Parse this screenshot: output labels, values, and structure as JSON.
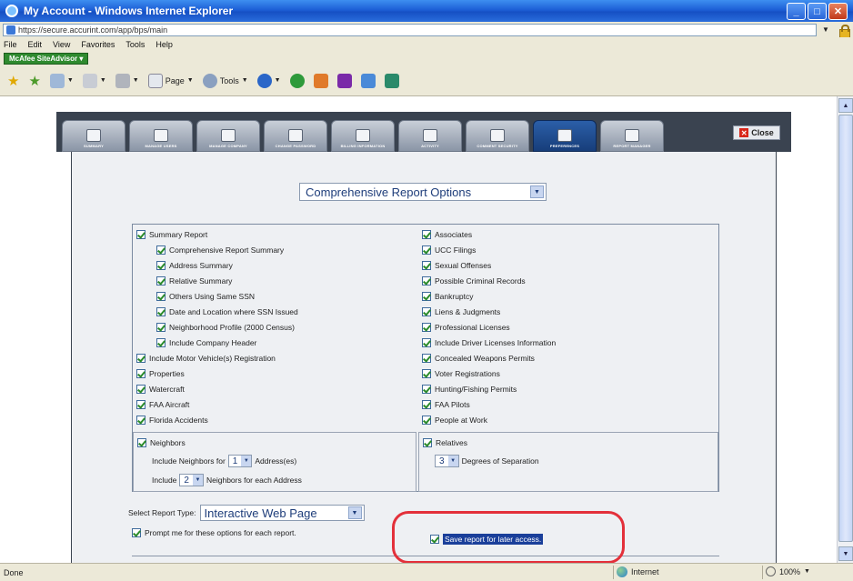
{
  "window": {
    "title": "My Account - Windows Internet Explorer"
  },
  "address": {
    "url": "https://secure.accurint.com/app/bps/main"
  },
  "menu": [
    "File",
    "Edit",
    "View",
    "Favorites",
    "Tools",
    "Help"
  ],
  "mcafee": {
    "label": "McAfee SiteAdvisor ▾"
  },
  "toolbar": {
    "page_label": "Page",
    "tools_label": "Tools"
  },
  "tabs": [
    {
      "label": "Summary"
    },
    {
      "label": "Manage Users"
    },
    {
      "label": "Manage Company"
    },
    {
      "label": "Change Password"
    },
    {
      "label": "Billing Information"
    },
    {
      "label": "Activity"
    },
    {
      "label": "Comment Security"
    },
    {
      "label": "Preferences"
    },
    {
      "label": "Report Manager"
    }
  ],
  "close_label": "Close",
  "report_options": {
    "selected": "Comprehensive Report Options"
  },
  "left_options": [
    "Summary Report",
    "Comprehensive Report Summary",
    "Address Summary",
    "Relative Summary",
    "Others Using Same SSN",
    "Date and Location where SSN Issued",
    "Neighborhood Profile (2000 Census)",
    "Include Company Header",
    "Include Motor Vehicle(s) Registration",
    "Properties",
    "Watercraft",
    "FAA Aircraft",
    "Florida Accidents"
  ],
  "right_options": [
    "Associates",
    "UCC Filings",
    "Sexual Offenses",
    "Possible Criminal Records",
    "Bankruptcy",
    "Liens & Judgments",
    "Professional Licenses",
    "Include Driver Licenses Information",
    "Concealed Weapons Permits",
    "Voter Registrations",
    "Hunting/Fishing Permits",
    "FAA Pilots",
    "People at Work"
  ],
  "neighbors": {
    "label": "Neighbors",
    "line1_prefix": "Include Neighbors for",
    "line1_value": "1",
    "line1_suffix": "Address(es)",
    "line2_prefix": "Include",
    "line2_value": "2",
    "line2_suffix": "Neighbors for each Address"
  },
  "relatives": {
    "label": "Relatives",
    "value": "3",
    "suffix": "Degrees of Separation"
  },
  "report_type": {
    "label": "Select Report Type:",
    "selected": "Interactive Web Page"
  },
  "prompt_option": "Prompt me for these options for each report.",
  "save_option": "Save report for later access.",
  "status": {
    "left": "Done",
    "zone": "Internet",
    "zoom": "100%"
  }
}
